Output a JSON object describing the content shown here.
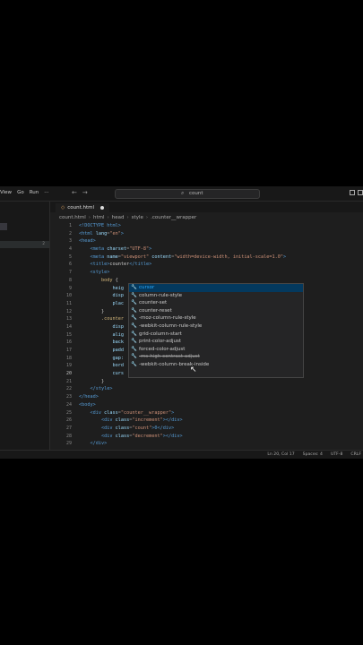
{
  "menu": [
    "View",
    "Go",
    "Run",
    "···"
  ],
  "nav": {
    "back": "←",
    "forward": "→"
  },
  "search": {
    "text": "count"
  },
  "tab": {
    "label": "count.html"
  },
  "breadcrumb": [
    "count.html",
    "html",
    "head",
    "style",
    ".counter__wrapper"
  ],
  "sidebar": {
    "row_badge": "2"
  },
  "line_numbers": [
    "1",
    "2",
    "3",
    "4",
    "5",
    "6",
    "7",
    "8",
    "9",
    "10",
    "11",
    "12",
    "13",
    "14",
    "15",
    "16",
    "17",
    "18",
    "19",
    "20",
    "21",
    "22",
    "23",
    "24",
    "25",
    "26",
    "27",
    "28",
    "29"
  ],
  "code": {
    "l1": "<!DOCTYPE html>",
    "l2_a": "<html ",
    "l2_b": "lang",
    "l2_c": "=",
    "l2_d": "\"en\"",
    "l2_e": ">",
    "l3": "<head>",
    "l4_a": "<meta ",
    "l4_b": "charset",
    "l4_c": "=",
    "l4_d": "\"UTF-8\"",
    "l4_e": ">",
    "l5_a": "<meta ",
    "l5_b": "name",
    "l5_c": "=",
    "l5_d": "\"viewport\"",
    "l5_e": " content",
    "l5_f": "=",
    "l5_g": "\"width=device-width, initial-scale=1.0\"",
    "l5_h": ">",
    "l6_a": "<title>",
    "l6_b": "counter",
    "l6_c": "</title>",
    "l7": "<style>",
    "l8_a": "body",
    "l8_b": " {",
    "l9": "heig",
    "l10": "disp",
    "l11": "plac",
    "l12": "}",
    "l13": ".counter",
    "l14": "disp",
    "l15": "alig",
    "l16": "back",
    "l17": "padd",
    "l18": "gap:",
    "l19": "bord",
    "l20": "curs",
    "l21": "}",
    "l22": "</style>",
    "l23": "</head>",
    "l24": "<body>",
    "l25_a": "<div ",
    "l25_b": "class",
    "l25_c": "=",
    "l25_d": "\"counter__wrapper\"",
    "l25_e": ">",
    "l26_a": "<div ",
    "l26_b": "class",
    "l26_c": "=",
    "l26_d": "\"increment\"",
    "l26_e": "></div>",
    "l27_a": "<div ",
    "l27_b": "class",
    "l27_c": "=",
    "l27_d": "\"count\"",
    "l27_e": ">0</div>",
    "l28_a": "<div ",
    "l28_b": "class",
    "l28_c": "=",
    "l28_d": "\"decrement\"",
    "l28_e": "></div>",
    "l29": "</div>"
  },
  "suggestions": [
    {
      "label": "cursor"
    },
    {
      "label": "column-rule-style"
    },
    {
      "label": "counter-set"
    },
    {
      "label": "counter-reset"
    },
    {
      "label": "-moz-column-rule-style"
    },
    {
      "label": "-webkit-column-rule-style"
    },
    {
      "label": "grid-column-start"
    },
    {
      "label": "print-color-adjust"
    },
    {
      "label": "forced-color-adjust"
    },
    {
      "label": "-ms-high-contrast-adjust"
    },
    {
      "label": "-webkit-column-break-inside"
    }
  ],
  "status": {
    "position": "Ln 20, Col 17",
    "spaces": "Spaces: 4",
    "encoding": "UTF-8",
    "eol": "CRLF"
  },
  "colors": {
    "tag": "#569cd6",
    "attr": "#9cdcfe",
    "string": "#ce9178",
    "selector": "#d7ba7d",
    "accent": "#2aaaff"
  }
}
